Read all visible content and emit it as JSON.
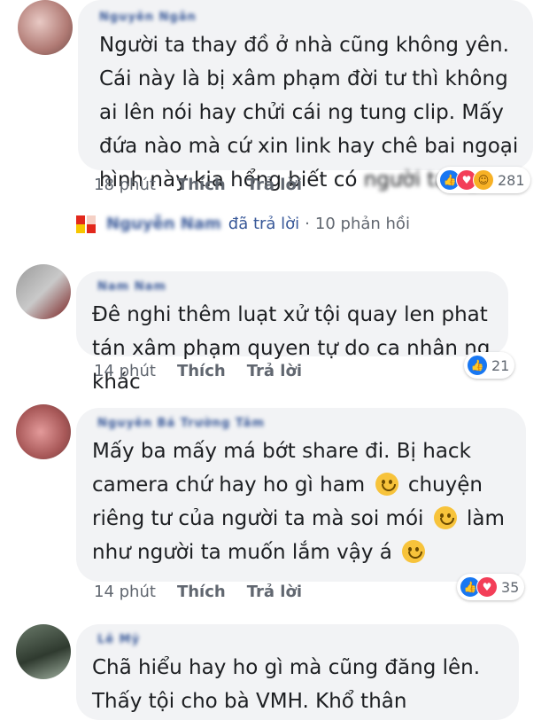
{
  "comments": [
    {
      "name": "Nguyễn Ngân",
      "text": "Người ta thay đồ ở nhà cũng không yên. Cái này là bị xâm phạm đời tư thì không ai lên nói hay chửi cái ng tung clip. Mấy đứa nào mà cứ xin link hay chê bai ngoại hình này kia hổng biết có",
      "text_blur": "người ta ngh",
      "time": "18 phút",
      "like": "Thích",
      "reply": "Trả lời",
      "reaction_count": "281"
    },
    {
      "name": "Nam Nam",
      "text": "Đê nghi thêm luạt xử tội quay len phat tán xâm phạm quyen tự do ca nhân ng khác",
      "time": "14 phút",
      "like": "Thích",
      "reply": "Trả lời",
      "reaction_count": "21"
    },
    {
      "name": "Nguyễn Bá Trường Tâm",
      "text_parts": [
        "Mấy ba mấy má bớt share đi. Bị hack camera chứ hay ho gì ham ",
        " chuyện riêng tư của người ta mà soi mói ",
        " làm như người ta muốn lắm vậy á "
      ],
      "time": "14 phút",
      "like": "Thích",
      "reply": "Trả lời",
      "reaction_count": "35"
    },
    {
      "name": "Lê Mỹ",
      "text": "Chã hiểu hay ho gì mà cũng đăng lên. Thấy tội cho bà VMH. Khổ thân"
    }
  ],
  "reply_summary": {
    "name": "Nguyễn Nam",
    "action": "đã trả lời",
    "separator": "·",
    "count": "10 phản hồi"
  },
  "icons": [
    "like-reaction-icon",
    "love-reaction-icon",
    "haha-reaction-icon",
    "smile-emoji-icon"
  ],
  "colors": {
    "bubble": "#f2f3f5",
    "link": "#385898",
    "meta": "#616770",
    "like": "#1877f2",
    "love": "#f33e58"
  }
}
